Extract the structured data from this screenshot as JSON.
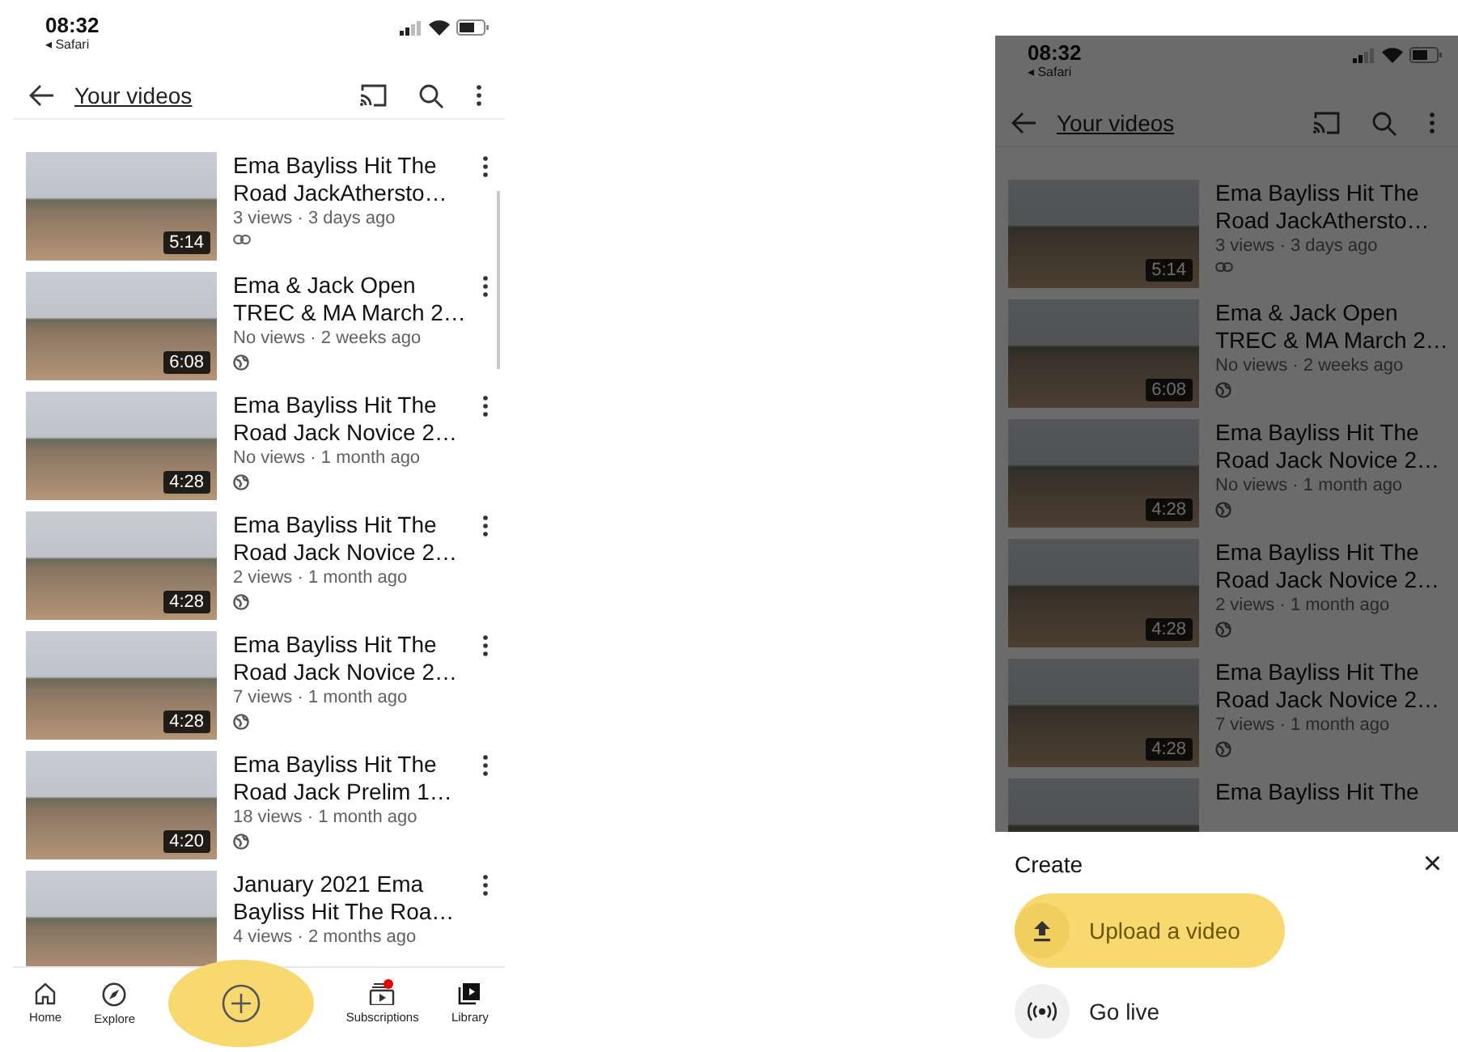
{
  "screens": [
    {
      "dimmed": false,
      "show_item_menus": true,
      "status": {
        "time": "08:32",
        "back_app": "◂ Safari"
      },
      "header": {
        "title": "Your videos"
      },
      "videos": [
        {
          "title": "Ema Bayliss Hit The Road JackAthersto…",
          "duration": "5:14",
          "meta": "3 views · 3 days ago",
          "kind": "unlisted"
        },
        {
          "title": "Ema & Jack Open TREC & MA March 2…",
          "duration": "6:08",
          "meta": "No views · 2 weeks ago",
          "kind": "public"
        },
        {
          "title": "Ema Bayliss Hit The Road Jack Novice 2…",
          "duration": "4:28",
          "meta": "No views · 1 month ago",
          "kind": "public"
        },
        {
          "title": "Ema Bayliss Hit The Road Jack Novice 2…",
          "duration": "4:28",
          "meta": "2 views · 1 month ago",
          "kind": "public"
        },
        {
          "title": "Ema Bayliss Hit The Road Jack Novice 2…",
          "duration": "4:28",
          "meta": "7 views · 1 month ago",
          "kind": "public"
        },
        {
          "title": "Ema Bayliss Hit The Road Jack Prelim 1…",
          "duration": "4:20",
          "meta": "18 views · 1 month ago",
          "kind": "public"
        },
        {
          "title": "January 2021 Ema Bayliss Hit The Roa…",
          "meta": "4 views · 2 months ago"
        }
      ],
      "nav": [
        {
          "kind": "home",
          "label": "Home",
          "badge": false,
          "highlighted": false
        },
        {
          "kind": "explore",
          "label": "Explore",
          "badge": false,
          "highlighted": false
        },
        {
          "kind": "create",
          "highlighted": true,
          "badge": false
        },
        {
          "kind": "subscriptions",
          "label": "Subscriptions",
          "badge": true,
          "highlighted": false
        },
        {
          "kind": "library",
          "label": "Library",
          "badge": false,
          "highlighted": false
        }
      ]
    },
    {
      "dimmed": true,
      "show_item_menus": false,
      "status": {
        "time": "08:32",
        "back_app": "◂ Safari"
      },
      "header": {
        "title": "Your videos"
      },
      "videos": [
        {
          "title": "Ema Bayliss Hit The Road JackAthersto…",
          "duration": "5:14",
          "meta": "3 views · 3 days ago",
          "kind": "unlisted"
        },
        {
          "title": "Ema & Jack Open TREC & MA March 2…",
          "duration": "6:08",
          "meta": "No views · 2 weeks ago",
          "kind": "public"
        },
        {
          "title": "Ema Bayliss Hit The Road Jack Novice 2…",
          "duration": "4:28",
          "meta": "No views · 1 month ago",
          "kind": "public"
        },
        {
          "title": "Ema Bayliss Hit The Road Jack Novice 2…",
          "duration": "4:28",
          "meta": "2 views · 1 month ago",
          "kind": "public"
        },
        {
          "title": "Ema Bayliss Hit The Road Jack Novice 2…",
          "duration": "4:28",
          "meta": "7 views · 1 month ago",
          "kind": "public"
        },
        {
          "title": "Ema Bayliss Hit The"
        }
      ],
      "sheet": {
        "title": "Create",
        "close": "×",
        "options": [
          {
            "kind": "upload",
            "label": "Upload a video",
            "highlighted": true
          },
          {
            "kind": "live",
            "label": "Go live",
            "highlighted": false
          }
        ]
      }
    }
  ]
}
